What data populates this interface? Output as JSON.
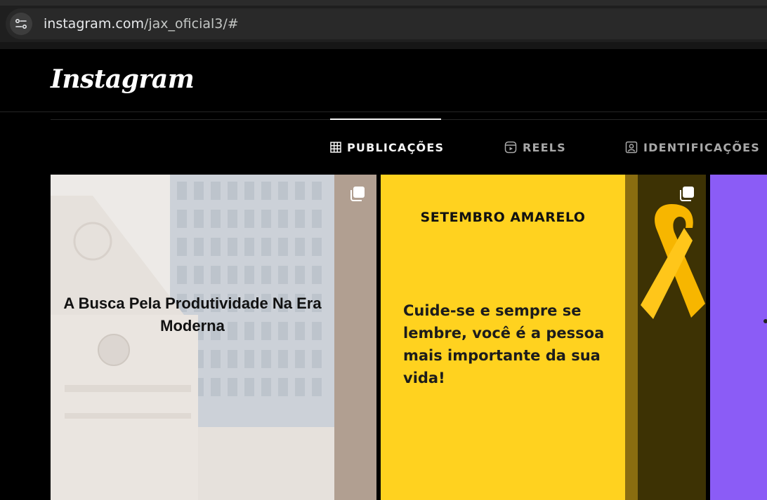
{
  "browser": {
    "url_host": "instagram.com",
    "url_path": "/jax_oficial3/#"
  },
  "header": {
    "logo_text": "Instagram"
  },
  "tabs": [
    {
      "label": "PUBLICAÇÕES",
      "icon": "grid-icon",
      "active": true
    },
    {
      "label": "REELS",
      "icon": "reels-icon",
      "active": false
    },
    {
      "label": "IDENTIFICAÇÕES",
      "icon": "tagged-icon",
      "active": false
    }
  ],
  "posts": [
    {
      "title": "A Busca Pela Produtividade Na Era Moderna",
      "multi": true,
      "icon": "carousel-icon"
    },
    {
      "heading": "SETEMBRO AMARELO",
      "body": "Cuide-se e sempre se lembre, você é a pessoa mais importante da sua vida!",
      "multi": true,
      "icon": "carousel-icon"
    },
    {
      "multi": false
    }
  ],
  "colors": {
    "background": "#000000",
    "post2_yellow": "#ffd21f",
    "post3_purple": "#8b5cf6",
    "ribbon": "#ffb400"
  }
}
